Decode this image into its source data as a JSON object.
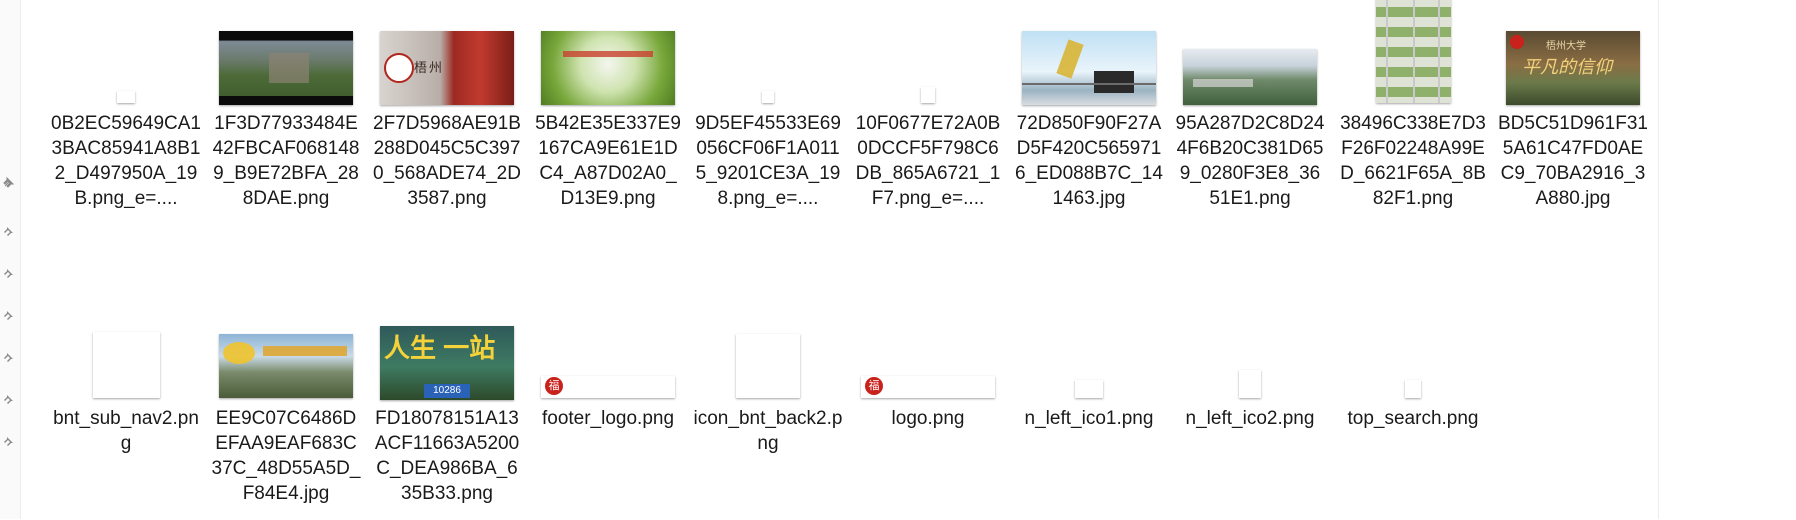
{
  "files": [
    {
      "name": "0B2EC59649CA13BAC85941A8B12_D497950A_19B.png_e=...."
    },
    {
      "name": "1F3D77933484E42FBCAF0681489_B9E72BFA_288DAE.png"
    },
    {
      "name": "2F7D5968AE91B288D045C5C3970_568ADE74_2D3587.png"
    },
    {
      "name": "5B42E35E337E9167CA9E61E1DC4_A87D02A0_D13E9.png"
    },
    {
      "name": "9D5EF45533E69056CF06F1A0115_9201CE3A_198.png_e=...."
    },
    {
      "name": "10F0677E72A0B0DCCF5F798C6DB_865A6721_1F7.png_e=...."
    },
    {
      "name": "72D850F90F27AD5F420C5659716_ED088B7C_141463.jpg"
    },
    {
      "name": "95A287D2C8D244F6B20C381D659_0280F3E8_3651E1.png"
    },
    {
      "name": "38496C338E7D3F26F02248A99ED_6621F65A_8B82F1.png"
    },
    {
      "name": "BD5C51D961F315A61C47FD0AEC9_70BA2916_3A880.jpg"
    },
    {
      "name": "bnt_sub_nav2.png"
    },
    {
      "name": "EE9C07C6486DEFAA9EAF683C37C_48D55A5D_F84E4.jpg"
    },
    {
      "name": "FD18078151A13ACF11663A5200C_DEA986BA_635B33.png"
    },
    {
      "name": "footer_logo.png"
    },
    {
      "name": "icon_bnt_back2.png"
    },
    {
      "name": "logo.png"
    },
    {
      "name": "n_left_ico1.png"
    },
    {
      "name": "n_left_ico2.png"
    },
    {
      "name": "top_search.png"
    }
  ],
  "thumbnail_text": {
    "f3_sign": "梧州",
    "f10_line1": "梧州大学",
    "f10_line2": "平凡的信仰",
    "f13_big": "人生 一站",
    "f13_plate": "10286",
    "seal_char": "福"
  },
  "colors": {
    "seal_red": "#c9221c",
    "text": "#1a1a1a"
  }
}
